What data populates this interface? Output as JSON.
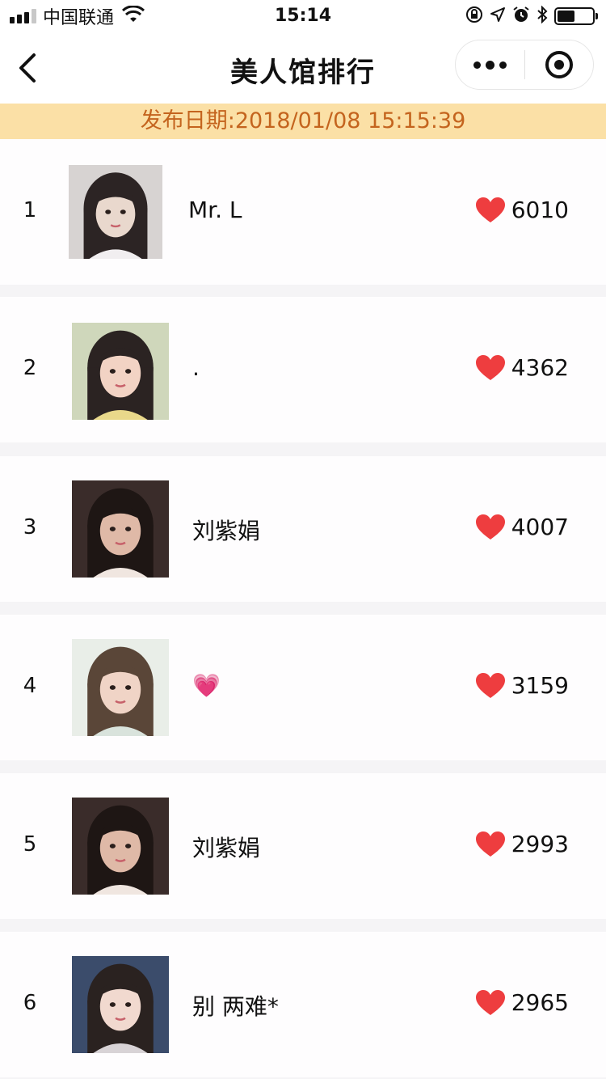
{
  "status_bar": {
    "carrier": "中国联通",
    "time": "15:14",
    "battery_level": 0.5
  },
  "nav": {
    "title": "美人馆排行",
    "back_icon": "chevron-left-icon",
    "more_icon": "more-dots-icon",
    "close_icon": "target-close-icon"
  },
  "banner": {
    "text": "发布日期:2018/01/08 15:15:39",
    "color": "#c4641e",
    "background": "#fbe0a6"
  },
  "ranking": [
    {
      "rank": "1",
      "name": "Mr. L",
      "likes": "6010",
      "avatar_icon": "user-photo"
    },
    {
      "rank": "2",
      "name": ".",
      "likes": "4362",
      "avatar_icon": "user-photo"
    },
    {
      "rank": "3",
      "name": "刘紫娟",
      "likes": "4007",
      "avatar_icon": "user-photo"
    },
    {
      "rank": "4",
      "name": "💗",
      "likes": "3159",
      "avatar_icon": "user-photo"
    },
    {
      "rank": "5",
      "name": "刘紫娟",
      "likes": "2993",
      "avatar_icon": "user-photo"
    },
    {
      "rank": "6",
      "name": "别 两难*",
      "likes": "2965",
      "avatar_icon": "user-photo"
    }
  ],
  "colors": {
    "heart": "#ee3d3f",
    "row_bg": "#fefdfe",
    "separator": "#f5f4f6"
  }
}
